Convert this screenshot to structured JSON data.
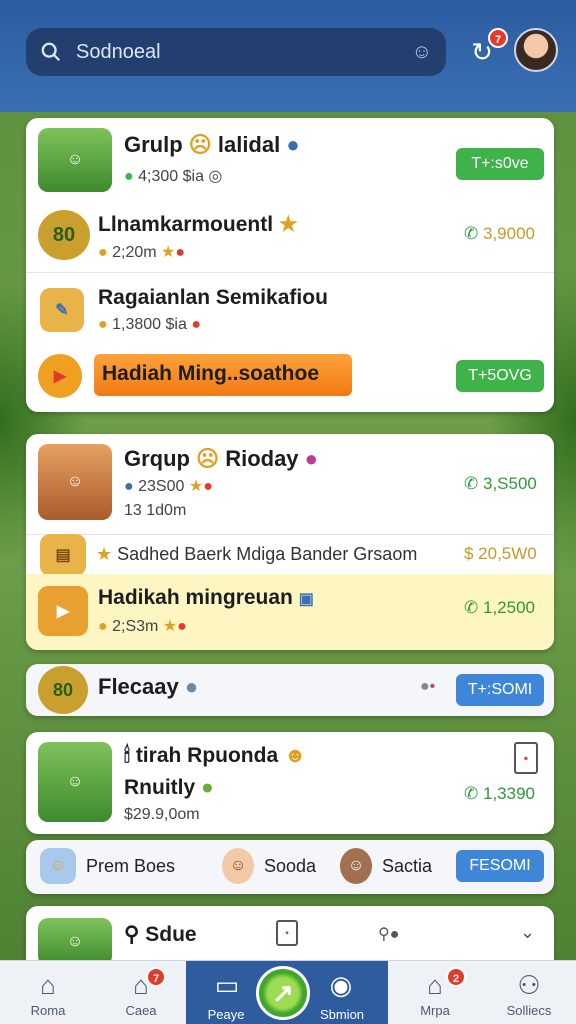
{
  "search": {
    "placeholder": "Sodnoeal"
  },
  "header": {
    "notification_count": "7"
  },
  "card1": {
    "item1": {
      "title": "Grulp",
      "title2": "lalidal",
      "sub": "4;300 $ia",
      "button": "T+:s0ve"
    },
    "item2": {
      "title": "Llnamkarmouentl",
      "sub": "2;20m",
      "price": "3,9000"
    },
    "item3": {
      "title": "Ragaianlan Semikafiou",
      "sub": "1,3800 $ia"
    },
    "item4": {
      "title": "Hadiah Ming..soathoe",
      "button": "T+5OVG"
    }
  },
  "card2": {
    "item1": {
      "title": "Grqup",
      "title2": "Rioday",
      "sub": "23S00",
      "sub2": "13 1d0m",
      "price": "3,S500"
    },
    "item2": {
      "title": "Sadhed Baerk Mdiga Bander Grsaom",
      "price": "$ 20,5W0"
    },
    "item3": {
      "title": "Hadikah mingreuan",
      "sub": "2;S3m",
      "price": "1,2500"
    }
  },
  "card3": {
    "title": "Flecaay",
    "button": "T+:SOMI"
  },
  "card4": {
    "title": "tirah Rpuonda",
    "title2": "Rnuitly",
    "sub": "$29.9,0om",
    "price": "1,3390"
  },
  "card5": {
    "items": [
      "Prem Boes",
      "Sooda",
      "Sactia"
    ],
    "button": "FESOMI"
  },
  "card6": {
    "title": "Sdue"
  },
  "nav": {
    "items": [
      {
        "label": "Roma",
        "badge": ""
      },
      {
        "label": "Caea",
        "badge": "7"
      },
      {
        "label": "Peaye",
        "badge": ""
      },
      {
        "label": "Sbmion",
        "badge": ""
      },
      {
        "label": "Mrpa",
        "badge": "2"
      },
      {
        "label": "Solliecs",
        "badge": ""
      }
    ]
  }
}
